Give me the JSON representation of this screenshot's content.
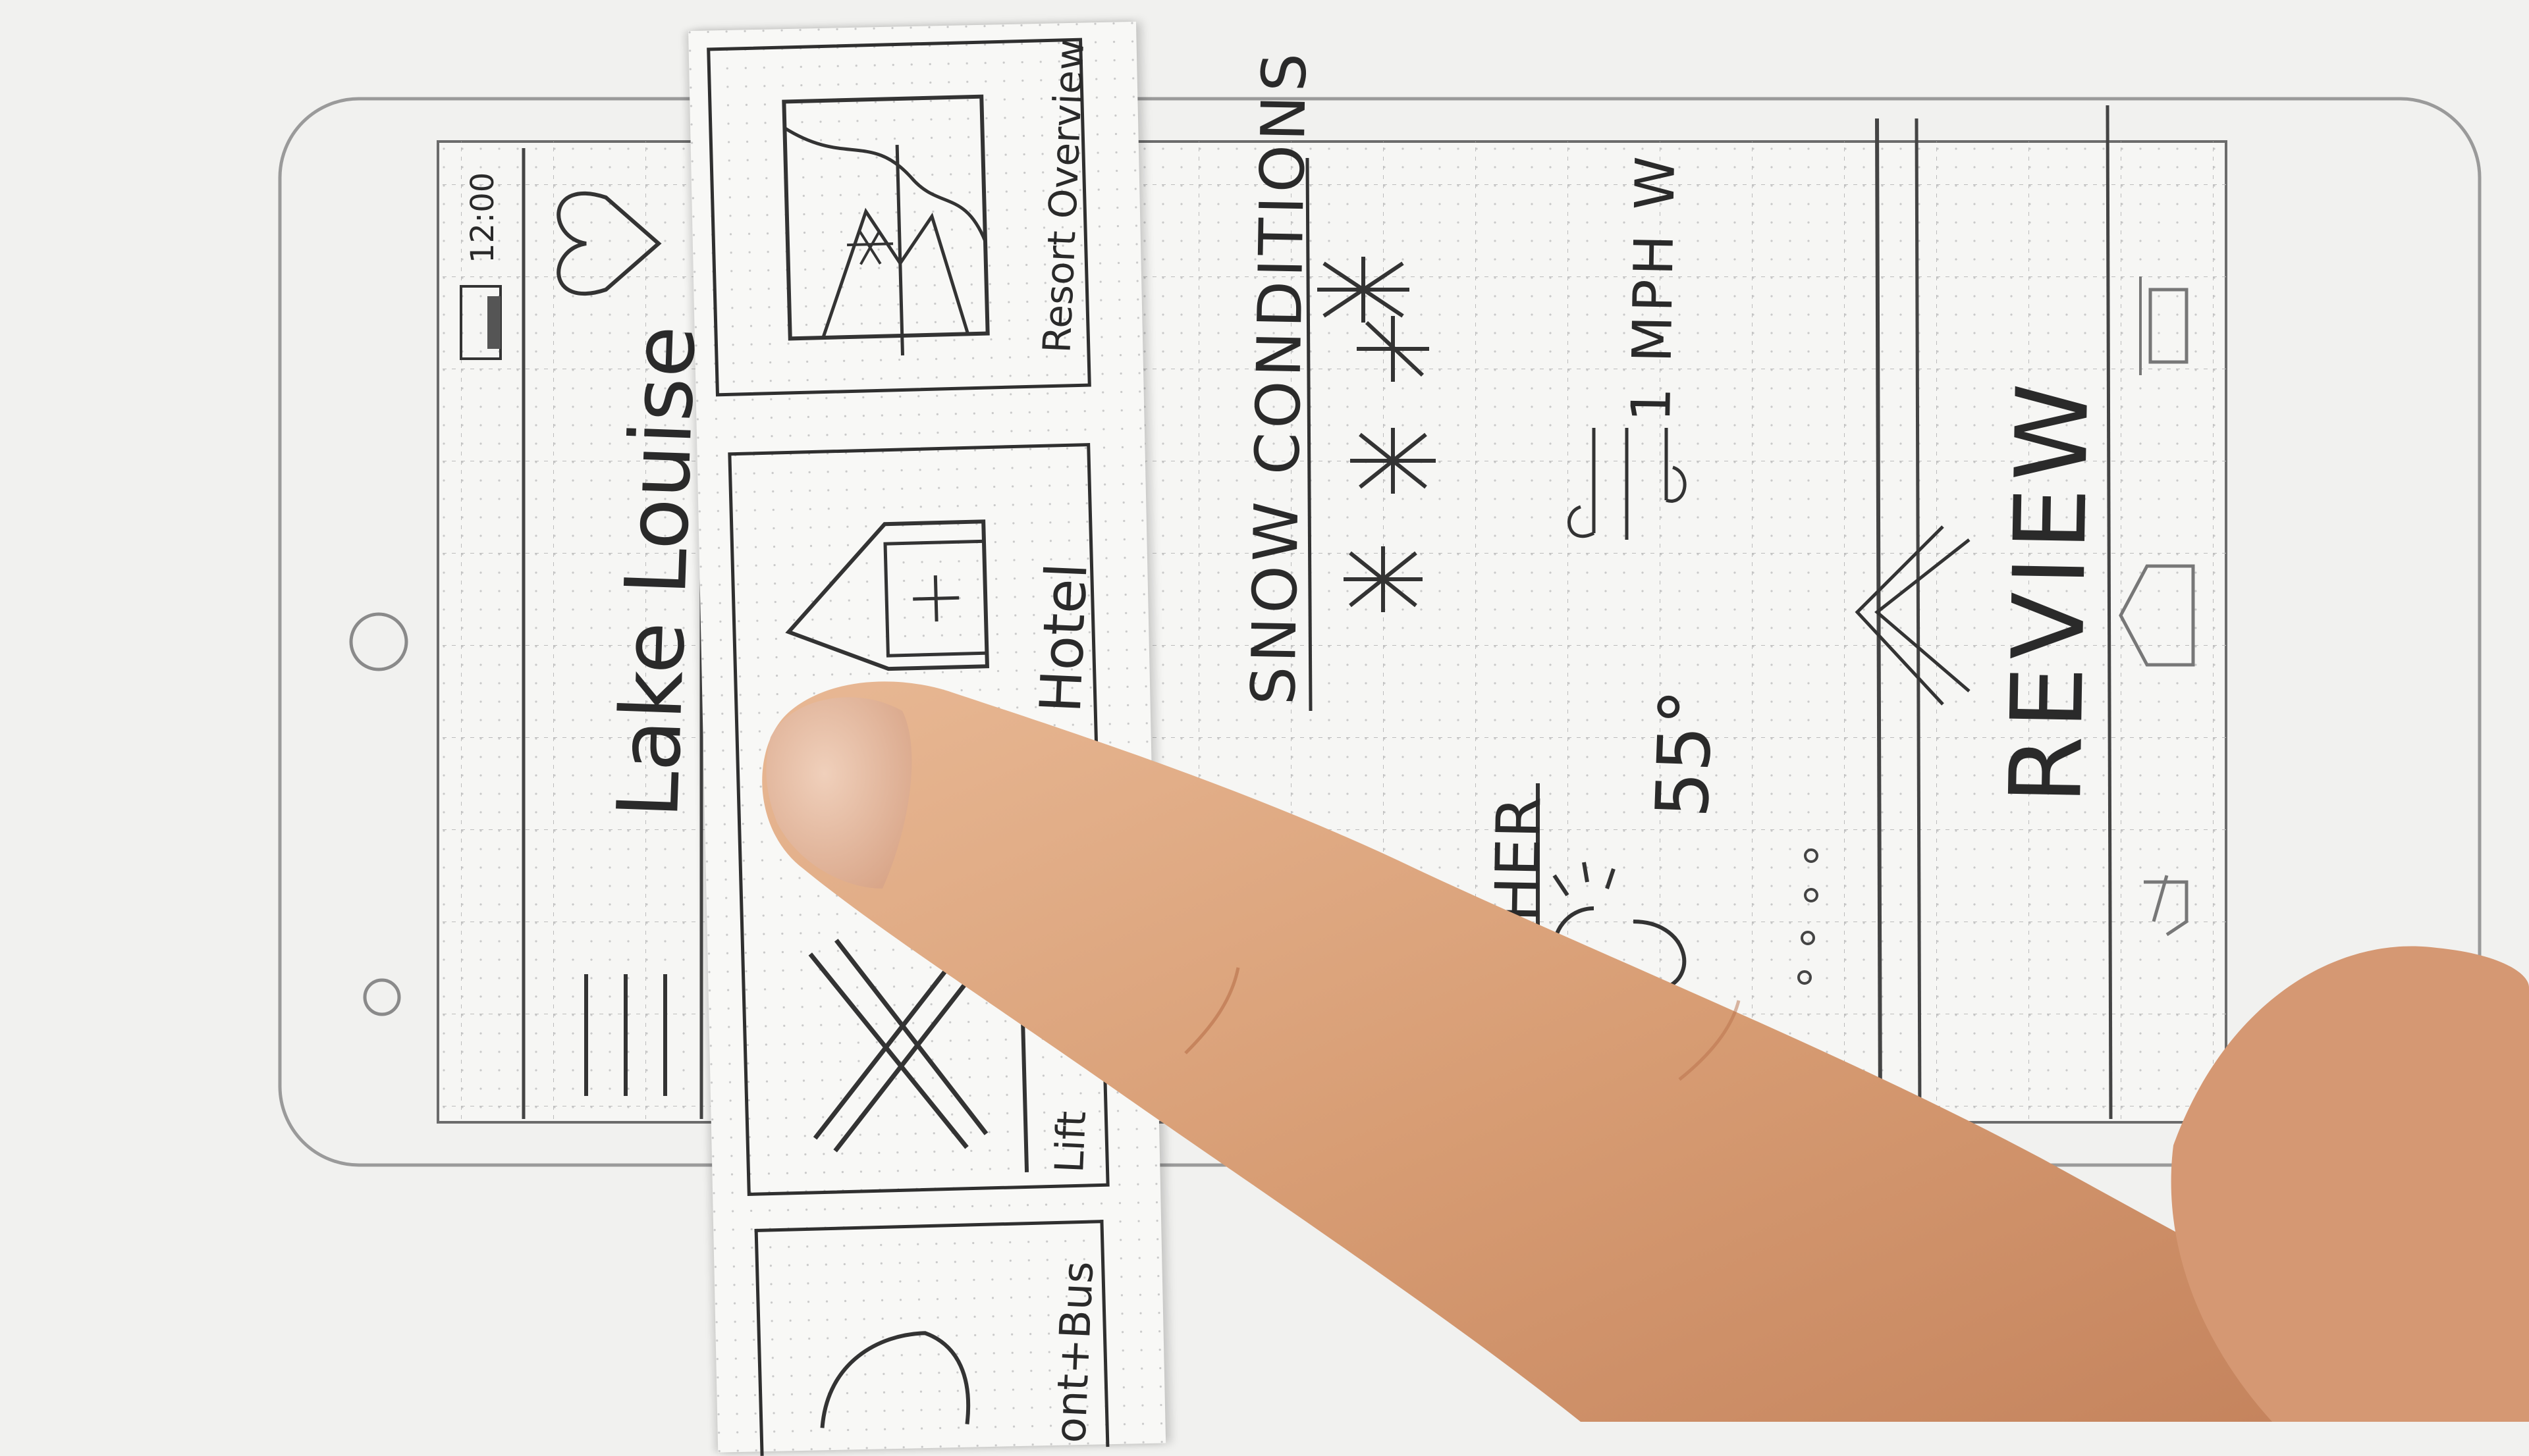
{
  "status_bar": {
    "time": "12:00",
    "battery_icon": "battery-icon"
  },
  "header": {
    "title": "Lake Louise",
    "menu_icon": "hamburger-menu-icon",
    "favorite_icon": "heart-icon"
  },
  "menu_cards": [
    {
      "label": "Resort Overview",
      "icon": "mountain-map-icon"
    },
    {
      "label": "Hotel",
      "icon": "hotel-house-icon"
    },
    {
      "label": "Lift",
      "icon": "crossed-skis-icon"
    },
    {
      "label": "ont+Bus",
      "icon": "transport-icon"
    }
  ],
  "snow_conditions": {
    "heading": "SNOW CONDITIONS",
    "icon": "snowflakes-icon"
  },
  "weather": {
    "heading": "HER",
    "icon": "sun-icon",
    "temperature": "55°",
    "wind_icon": "wind-icon",
    "wind": "1 MPH W"
  },
  "page_indicator": {
    "icon": "page-dots-icon",
    "count": 4
  },
  "review": {
    "label": "REVIEW",
    "icon": "chevron-up-icon"
  },
  "nav_bar": {
    "recents_icon": "recents-icon",
    "home_icon": "home-icon",
    "back_icon": "back-icon"
  },
  "colors": {
    "paper": "#f1f1ef",
    "pencil": "#2a2a2a",
    "grid_dot": "#c9c9c9",
    "skin": "#d9a079"
  }
}
